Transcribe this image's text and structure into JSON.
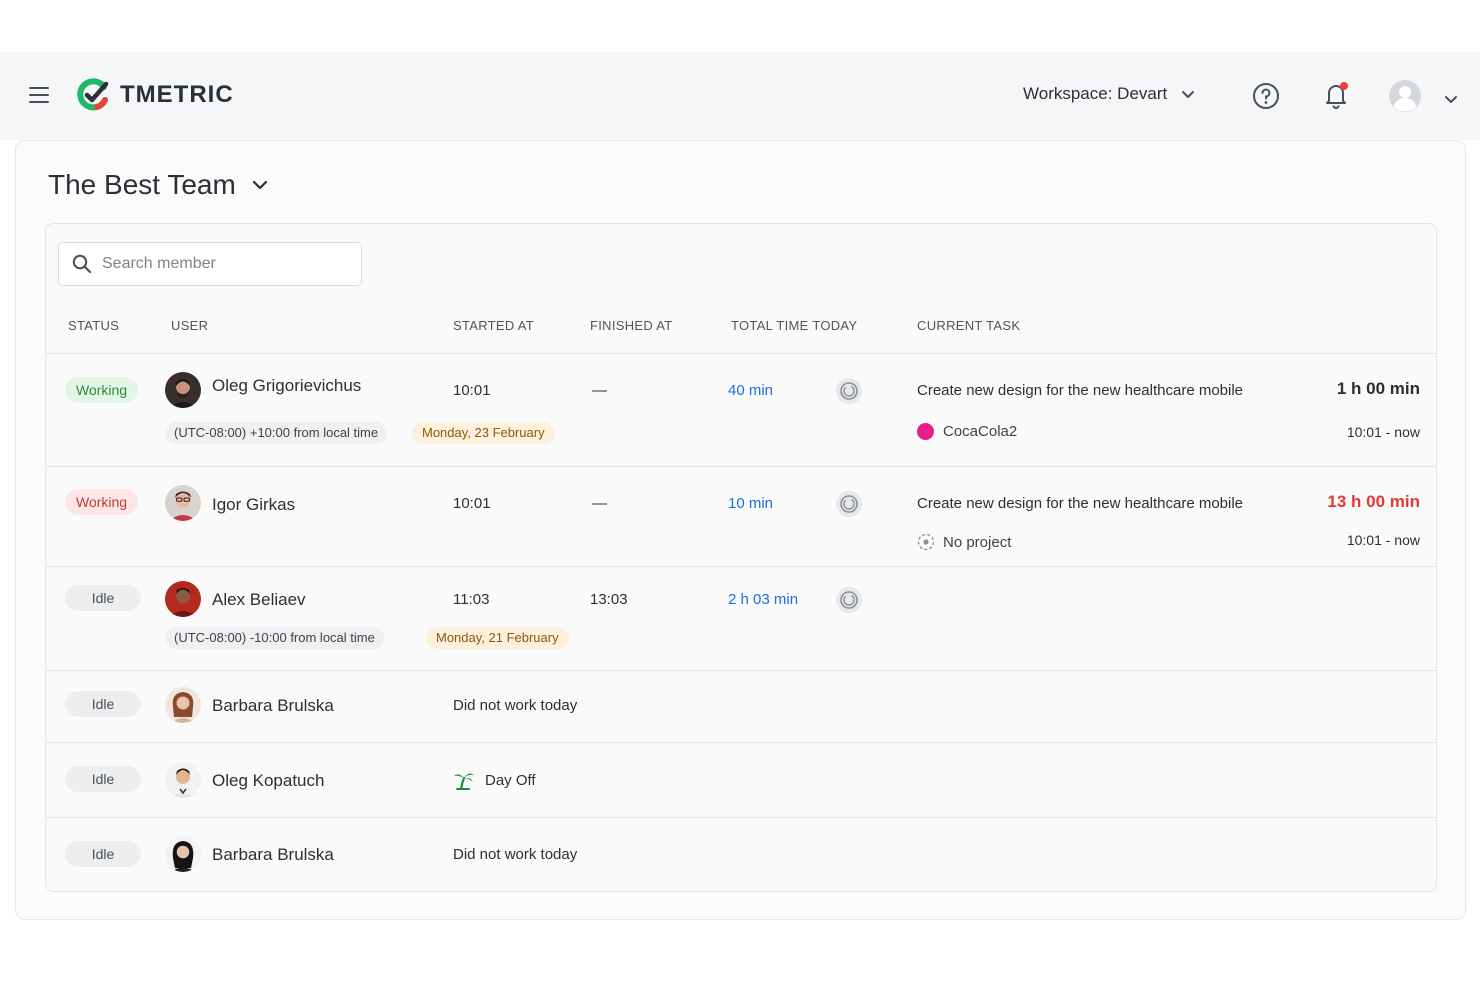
{
  "header": {
    "app_name": "TMETRIC",
    "workspace_label": "Workspace: Devart"
  },
  "team": {
    "title": "The Best Team"
  },
  "search": {
    "placeholder": "Search member"
  },
  "columns": [
    "STATUS",
    "USER",
    "STARTED AT",
    "FINISHED AT",
    "TOTAL TIME TODAY",
    "CURRENT TASK"
  ],
  "rows": [
    {
      "status": "Working",
      "name": "Oleg Grigorievichus",
      "started": "10:01",
      "finished": "—",
      "total": "40 min",
      "timezone": "(UTC-08:00) +10:00 from local time",
      "date": "Monday, 23 February",
      "task": "Create new design for the new healthcare mobile",
      "project": "CocaCola2",
      "duration": "1 h 00 min",
      "range": "10:01 - now"
    },
    {
      "status": "Working",
      "name": "Igor Girkas",
      "started": "10:01",
      "finished": "—",
      "total": "10 min",
      "task": "Create new design for the new healthcare mobile",
      "project": "No project",
      "duration": "13 h 00 min",
      "range": "10:01 - now"
    },
    {
      "status": "Idle",
      "name": "Alex Beliaev",
      "started": "11:03",
      "finished": "13:03",
      "total": "2 h 03 min",
      "timezone": "(UTC-08:00) -10:00 from local time",
      "date": "Monday, 21 February"
    },
    {
      "status": "Idle",
      "name": "Barbara Brulska",
      "note": "Did not work today"
    },
    {
      "status": "Idle",
      "name": "Oleg Kopatuch",
      "note": "Day Off"
    },
    {
      "status": "Idle",
      "name": "Barbara Brulska",
      "note": "Did not work today"
    }
  ],
  "colors": {
    "working_green": "#2f8a3a",
    "working_red": "#c8373a",
    "link_blue": "#1f6fe0",
    "project_pink": "#e91e8c",
    "overtime_red": "#e53935"
  }
}
